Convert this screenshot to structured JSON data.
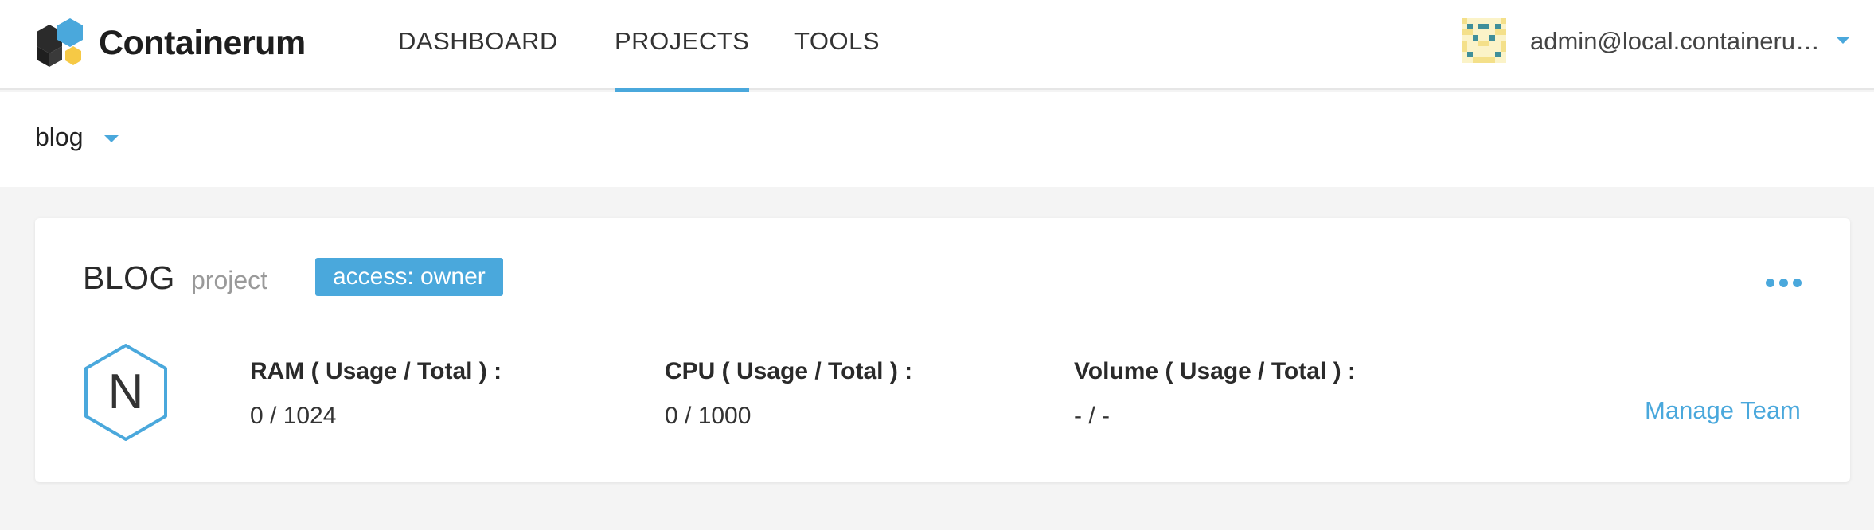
{
  "brand": {
    "name": "Containerum"
  },
  "nav": {
    "items": [
      {
        "label": "DASHBOARD",
        "active": false
      },
      {
        "label": "PROJECTS",
        "active": true
      },
      {
        "label": "TOOLS",
        "active": false
      }
    ]
  },
  "user": {
    "email": "admin@local.containerum.io"
  },
  "project_select": {
    "value": "blog"
  },
  "project": {
    "title": "BLOG",
    "type": "project",
    "access_badge": "access: owner",
    "icon_letter": "N",
    "stats": [
      {
        "label": "RAM ( Usage / Total ) :",
        "value": "0 / 1024"
      },
      {
        "label": "CPU ( Usage / Total ) :",
        "value": "0 / 1000"
      },
      {
        "label": "Volume ( Usage / Total ) :",
        "value": "- / -"
      }
    ],
    "manage_link": "Manage Team"
  },
  "colors": {
    "accent": "#4aa8dc",
    "logo_dark": "#2b2b2b",
    "logo_blue": "#4aa8dc",
    "logo_yellow": "#f6c945"
  }
}
